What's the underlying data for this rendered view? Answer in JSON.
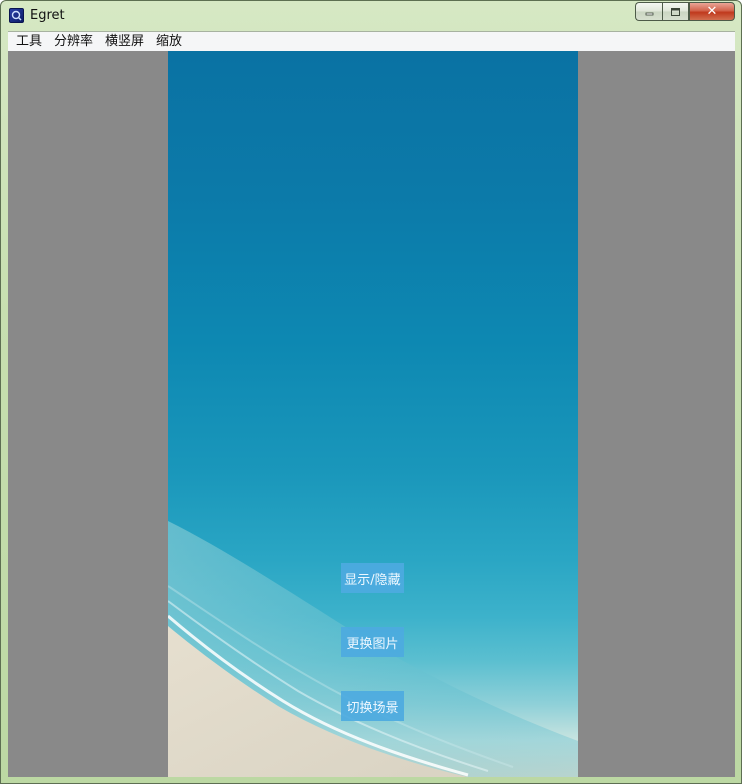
{
  "window": {
    "title": "Egret",
    "close_glyph": "✕",
    "icon": "egret-app-icon"
  },
  "menubar": {
    "items": [
      {
        "label": "工具"
      },
      {
        "label": "分辨率"
      },
      {
        "label": "横竖屏"
      },
      {
        "label": "缩放"
      }
    ]
  },
  "stage": {
    "background_description_colors": [
      "#0a72a3",
      "#1a97bb",
      "#5bbfd0",
      "#e5e0d0"
    ],
    "buttons": [
      {
        "label": "显示/隐藏"
      },
      {
        "label": "更换图片"
      },
      {
        "label": "切换场景"
      }
    ],
    "button_color": "#4daae0"
  },
  "client_background": "#898989"
}
